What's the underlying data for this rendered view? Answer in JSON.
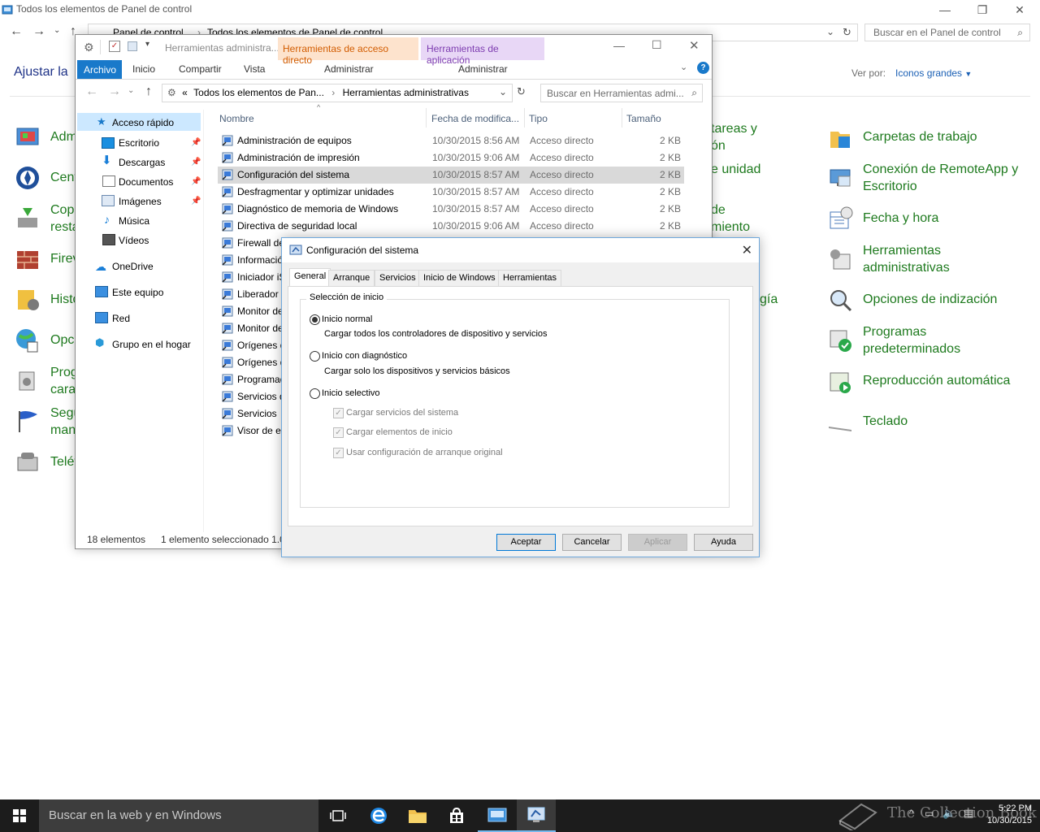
{
  "control_panel": {
    "window_title": "Todos los elementos de Panel de control",
    "breadcrumb": [
      "Panel de control",
      "Todos los elementos de Panel de control"
    ],
    "search_placeholder": "Buscar en el Panel de control",
    "heading": "Ajustar la",
    "view_by_label": "Ver por:",
    "view_by_value": "Iconos grandes",
    "left_items": [
      "Adm",
      "Cent",
      "Copi",
      "resta",
      "Firev",
      "Histo",
      "Opci",
      "Prog",
      "cara",
      "Segu",
      "man",
      "Teléf"
    ],
    "middle_items": [
      "tareas y",
      "ón",
      "e unidad",
      "de",
      "miento",
      "gía"
    ],
    "right_items": [
      "Carpetas de trabajo",
      "Conexión de RemoteApp y",
      "Escritorio",
      "Fecha y hora",
      "Herramientas",
      "administrativas",
      "Opciones de indización",
      "Programas",
      "predeterminados",
      "Reproducción automática",
      "Teclado"
    ]
  },
  "explorer": {
    "title": "Herramientas administra...",
    "context_tab_shortcut": "Herramientas de acceso directo",
    "context_tab_app": "Herramientas de aplicación",
    "ribbon_tabs": [
      "Archivo",
      "Inicio",
      "Compartir",
      "Vista"
    ],
    "context_sub_shortcut": "Administrar",
    "context_sub_app": "Administrar",
    "address": [
      "«",
      "Todos los elementos de Pan...",
      "Herramientas administrativas"
    ],
    "search_placeholder": "Buscar en Herramientas admi...",
    "nav": [
      {
        "label": "Acceso rápido"
      },
      {
        "label": "Escritorio"
      },
      {
        "label": "Descargas"
      },
      {
        "label": "Documentos"
      },
      {
        "label": "Imágenes"
      },
      {
        "label": "Música"
      },
      {
        "label": "Vídeos"
      },
      {
        "label": "OneDrive"
      },
      {
        "label": "Este equipo"
      },
      {
        "label": "Red"
      },
      {
        "label": "Grupo en el hogar"
      }
    ],
    "columns": [
      "Nombre",
      "Fecha de modifica...",
      "Tipo",
      "Tamaño"
    ],
    "files": [
      {
        "name": "Administración de equipos",
        "date": "10/30/2015 8:56 AM",
        "type": "Acceso directo",
        "size": "2 KB"
      },
      {
        "name": "Administración de impresión",
        "date": "10/30/2015 9:06 AM",
        "type": "Acceso directo",
        "size": "2 KB"
      },
      {
        "name": "Configuración del sistema",
        "date": "10/30/2015 8:57 AM",
        "type": "Acceso directo",
        "size": "2 KB"
      },
      {
        "name": "Desfragmentar y optimizar unidades",
        "date": "10/30/2015 8:57 AM",
        "type": "Acceso directo",
        "size": "2 KB"
      },
      {
        "name": "Diagnóstico de memoria de Windows",
        "date": "10/30/2015 8:57 AM",
        "type": "Acceso directo",
        "size": "2 KB"
      },
      {
        "name": "Directiva de seguridad local",
        "date": "10/30/2015 9:06 AM",
        "type": "Acceso directo",
        "size": "2 KB"
      },
      {
        "name": "Firewall de"
      },
      {
        "name": "Informació"
      },
      {
        "name": "Iniciador iS"
      },
      {
        "name": "Liberador d"
      },
      {
        "name": "Monitor de"
      },
      {
        "name": "Monitor de"
      },
      {
        "name": "Orígenes d"
      },
      {
        "name": "Orígenes d"
      },
      {
        "name": "Programad"
      },
      {
        "name": "Servicios d"
      },
      {
        "name": "Servicios"
      },
      {
        "name": "Visor de ev"
      }
    ],
    "selected_file": "Configuración del sistema",
    "status_count": "18 elementos",
    "status_selected": "1 elemento seleccionado  1.0"
  },
  "dialog": {
    "title": "Configuración del sistema",
    "tabs": [
      "General",
      "Arranque",
      "Servicios",
      "Inicio de Windows",
      "Herramientas"
    ],
    "active_tab": "General",
    "group_label": "Selección de inicio",
    "options": [
      {
        "label": "Inicio normal",
        "desc": "Cargar todos los controladores de dispositivo y servicios",
        "selected": true
      },
      {
        "label": "Inicio con diagnóstico",
        "desc": "Cargar solo los dispositivos y servicios básicos",
        "selected": false
      },
      {
        "label": "Inicio selectivo",
        "desc": "",
        "selected": false
      }
    ],
    "checkboxes": [
      {
        "label": "Cargar servicios del sistema",
        "checked": true,
        "enabled": false
      },
      {
        "label": "Cargar elementos de inicio",
        "checked": true,
        "enabled": false
      },
      {
        "label": "Usar configuración de arranque original",
        "checked": true,
        "enabled": false
      }
    ],
    "buttons": {
      "ok": "Aceptar",
      "cancel": "Cancelar",
      "apply": "Aplicar",
      "help": "Ayuda"
    }
  },
  "taskbar": {
    "search_placeholder": "Buscar en la web y en Windows",
    "time": "5:22 PM",
    "date": "10/30/2015",
    "watermark": "The Collection Book",
    "apps": [
      "task-view-icon",
      "edge-icon",
      "file-explorer-icon",
      "store-icon",
      "control-panel-icon",
      "msconfig-icon"
    ]
  },
  "colors": {
    "accent": "#1979ca",
    "cp_link_green": "#1e7a1e",
    "cp_heading_blue": "#1e3287",
    "context_shortcut_bg": "#fde3cd",
    "context_app_bg": "#e8d7f6",
    "selected_row": "#d9d9d9",
    "taskbar": "#1c1c1c"
  }
}
